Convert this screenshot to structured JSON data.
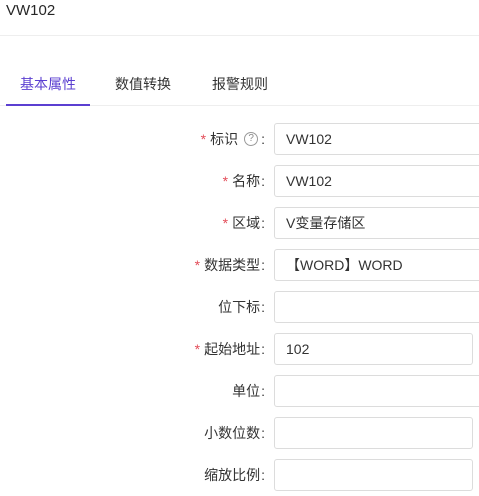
{
  "header": {
    "title": "VW102"
  },
  "tabs": [
    {
      "label": "基本属性",
      "active": true
    },
    {
      "label": "数值转换",
      "active": false
    },
    {
      "label": "报警规则",
      "active": false
    }
  ],
  "theme": {
    "accent": "#5b3fd1",
    "required_mark": "#e34d59"
  },
  "form": {
    "required_mark": "*",
    "help_icon": "question-circle-icon",
    "help_glyph": "?",
    "fields": [
      {
        "label": "标识",
        "colon": ":",
        "value": "VW102",
        "required": true,
        "help": true
      },
      {
        "label": "名称",
        "colon": ":",
        "value": "VW102",
        "required": true
      },
      {
        "label": "区域",
        "colon": ":",
        "value": "V变量存储区",
        "required": true
      },
      {
        "label": "数据类型",
        "colon": ":",
        "value": "【WORD】WORD",
        "required": true
      },
      {
        "label": "位下标",
        "colon": ":",
        "value": "",
        "required": false
      },
      {
        "label": "起始地址",
        "colon": ":",
        "value": "102",
        "required": true
      },
      {
        "label": "单位",
        "colon": ":",
        "value": "",
        "required": false
      },
      {
        "label": "小数位数",
        "colon": ":",
        "value": "",
        "required": false
      },
      {
        "label": "缩放比例",
        "colon": ":",
        "value": "",
        "required": false
      }
    ]
  }
}
